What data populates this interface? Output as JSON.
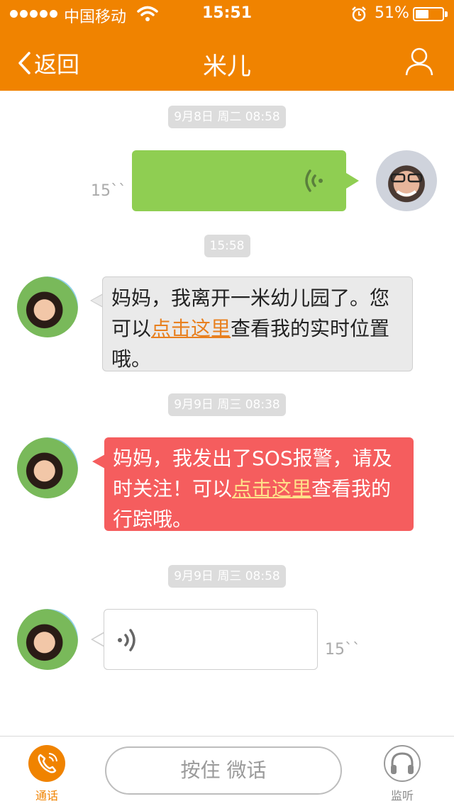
{
  "status_bar": {
    "carrier": "中国移动",
    "time": "15:51",
    "battery_percent": "51%",
    "battery_level": 0.51
  },
  "header": {
    "back_label": "返回",
    "title": "米儿",
    "profile_icon": "person-icon",
    "color": "#f08300"
  },
  "messages": [
    {
      "type": "timestamp",
      "text": "9月8日 周二 08:58"
    },
    {
      "type": "voice",
      "direction": "out",
      "duration": "15``",
      "color": "#8fce52"
    },
    {
      "type": "timestamp",
      "text": "15:58"
    },
    {
      "type": "text",
      "direction": "in",
      "parts": [
        "妈妈，我离开一米幼儿园了。您可以",
        "点击这里",
        "查看我的实时位置哦。"
      ],
      "color": "#eaeaea"
    },
    {
      "type": "timestamp",
      "text": "9月9日 周三 08:38"
    },
    {
      "type": "text",
      "direction": "in",
      "parts": [
        "妈妈，我发出了SOS报警，请及时关注！可以",
        "点击这里",
        "查看我的行踪哦。"
      ],
      "color": "#f55d5e"
    },
    {
      "type": "timestamp",
      "text": "9月9日 周三 08:58"
    },
    {
      "type": "voice",
      "direction": "in",
      "duration": "15``",
      "color": "#ffffff"
    }
  ],
  "bottom_bar": {
    "call_label": "通话",
    "hold_label": "按住 微话",
    "listen_label": "监听",
    "call_icon": "phone-icon",
    "listen_icon": "headphones-icon",
    "active_color": "#f08300"
  }
}
